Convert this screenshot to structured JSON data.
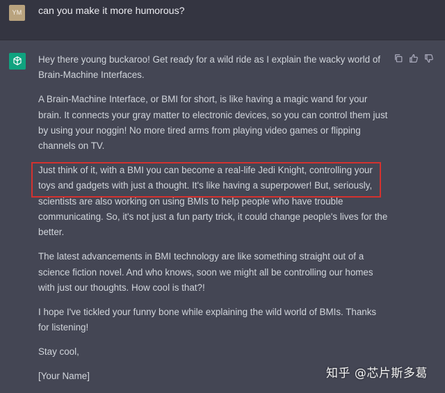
{
  "user_message": {
    "avatar_initials": "YM",
    "text": "can you make it more humorous?"
  },
  "assistant": {
    "avatar_icon": "openai-logo-icon",
    "actions": [
      "copy-icon",
      "thumbs-up-icon",
      "thumbs-down-icon"
    ],
    "paragraphs": [
      "Hey there young buckaroo! Get ready for a wild ride as I explain the wacky world of Brain-Machine Interfaces.",
      "A Brain-Machine Interface, or BMI for short, is like having a magic wand for your brain. It connects your gray matter to electronic devices, so you can control them just by using your noggin! No more tired arms from playing video games or flipping channels on TV.",
      "Just think of it, with a BMI you can become a real-life Jedi Knight, controlling your toys and gadgets with just a thought. It's like having a superpower! But, seriously, scientists are also working on using BMIs to help people who have trouble communicating. So, it's not just a fun party trick, it could change people's lives for the better.",
      "The latest advancements in BMI technology are like something straight out of a science fiction novel. And who knows, soon we might all be controlling our homes with just our thoughts. How cool is that?!",
      "I hope I've tickled your funny bone while explaining the wild world of BMIs. Thanks for listening!",
      "Stay cool,",
      "[Your Name]"
    ]
  },
  "watermark": "知乎 @芯片斯多葛",
  "colors": {
    "user_bg": "#343541",
    "assistant_bg": "#444654",
    "text": "#d1d5db",
    "avatar_user": "#b9a37e",
    "avatar_gpt": "#10a37f",
    "highlight": "#d4322f"
  }
}
